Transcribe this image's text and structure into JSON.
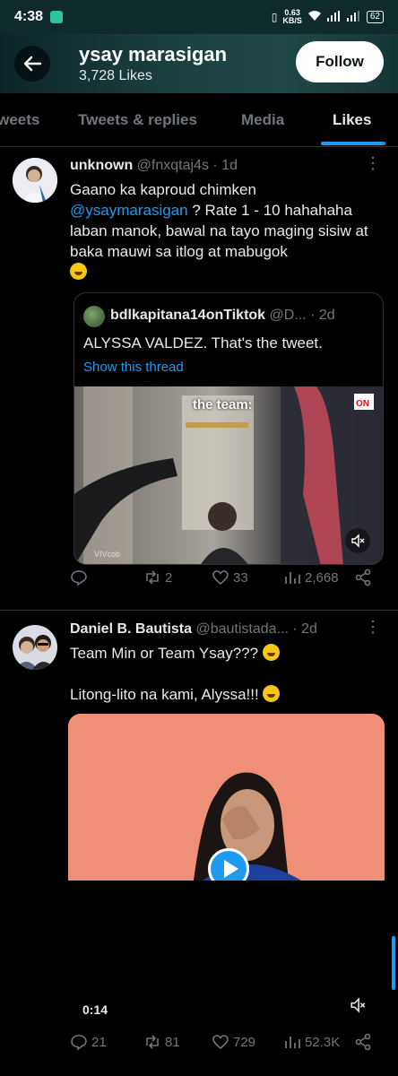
{
  "status": {
    "time": "4:38",
    "speed_top": "0.63",
    "speed_bottom": "KB/S",
    "battery": "62"
  },
  "header": {
    "name": "ysay marasigan",
    "likes": "3,728 Likes",
    "follow_label": "Follow"
  },
  "tabs": [
    {
      "label": "Tweets"
    },
    {
      "label": "Tweets & replies"
    },
    {
      "label": "Media"
    },
    {
      "label": "Likes"
    }
  ],
  "tweet1": {
    "name": "unknown",
    "handle": "@fnxqtaj4s · 1d",
    "text_a": "Gaano ka kaproud chimken",
    "mention": "@ysaymarasigan",
    "text_b": " ? Rate 1 - 10 hahahaha laban manok, bawal na tayo maging sisiw at baka mauwi sa itlog at mabugok",
    "quote": {
      "name": "bdlkapitana14onTiktok",
      "handle": "@D...",
      "time": "· 2d",
      "text": "ALYSSA VALDEZ. That's the tweet.",
      "link": "Show this thread",
      "caption": "the team:",
      "watermark": "VIVcob"
    },
    "replies": "",
    "retweets": "2",
    "likes": "33",
    "views": "2,668"
  },
  "tweet2": {
    "name": "Daniel B. Bautista",
    "handle": "@bautistada...",
    "time": "· 2d",
    "line1": "Team Min or Team Ysay???",
    "line2": "Litong-lito na kami, Alyssa!!!",
    "video_time": "0:14",
    "replies": "21",
    "retweets": "81",
    "likes": "729",
    "views": "52.3K"
  },
  "colors": {
    "accent": "#1d9bf0",
    "muted": "#71767b"
  },
  "icons": [
    "back-arrow-icon",
    "reply-icon",
    "retweet-icon",
    "heart-icon",
    "views-icon",
    "share-icon",
    "mute-icon",
    "play-icon",
    "more-icon"
  ]
}
